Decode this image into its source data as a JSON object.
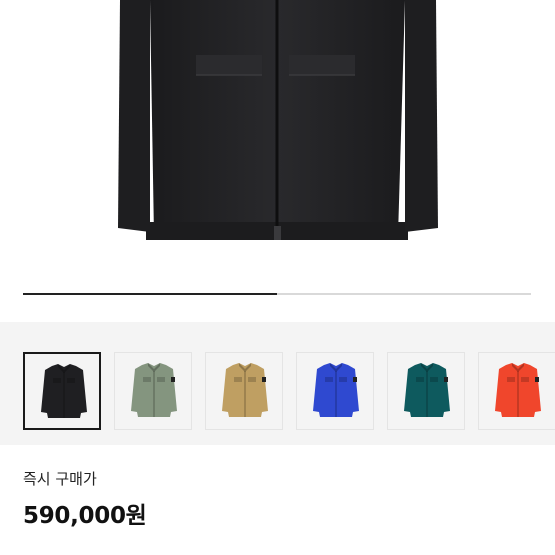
{
  "product": {
    "image_icon": "jacket-photo",
    "gallery_progress": 0.5,
    "thumbnails": [
      {
        "color": "#1f1f22",
        "icon": "jacket-thumbnail",
        "selected": true
      },
      {
        "color": "#84957f",
        "icon": "jacket-thumbnail",
        "selected": false
      },
      {
        "color": "#bf9f62",
        "icon": "jacket-thumbnail",
        "selected": false
      },
      {
        "color": "#2f49d0",
        "icon": "jacket-thumbnail",
        "selected": false
      },
      {
        "color": "#0e5a5e",
        "icon": "jacket-thumbnail",
        "selected": false
      },
      {
        "color": "#f0462c",
        "icon": "jacket-thumbnail",
        "selected": false
      }
    ],
    "buy_label": "즉시 구매가",
    "price": "590,000원"
  }
}
